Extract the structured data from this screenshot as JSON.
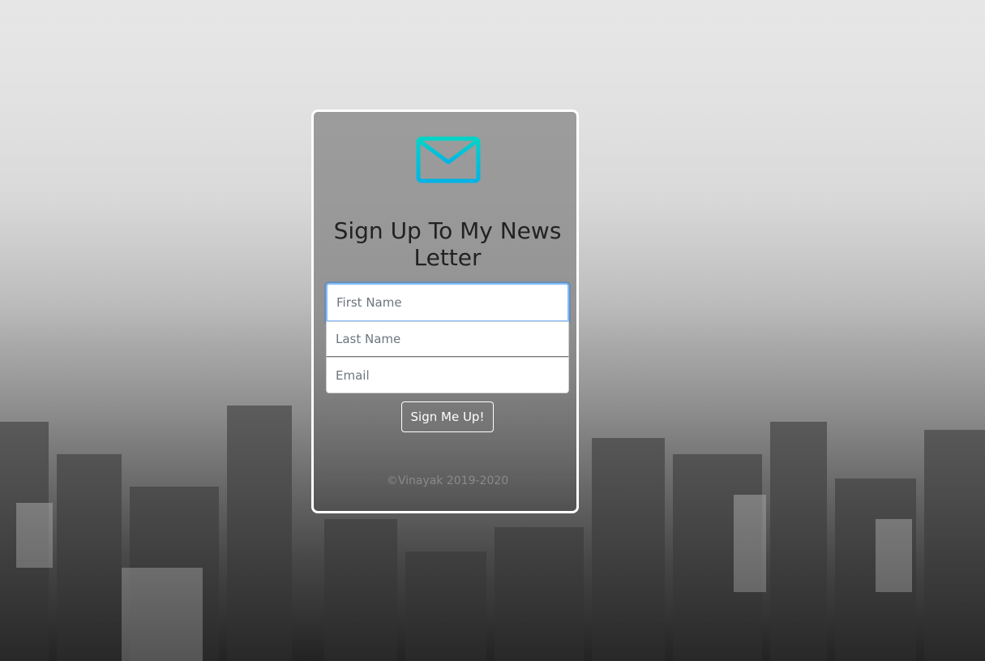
{
  "header": {
    "title": "Sign Up To My News Letter",
    "icon": "mail-icon",
    "icon_color": "#00c8d8"
  },
  "form": {
    "first_name_placeholder": "First Name",
    "last_name_placeholder": "Last Name",
    "email_placeholder": "Email",
    "submit_label": "Sign Me Up!"
  },
  "footer": {
    "copyright": "©Vinayak 2019-2020"
  },
  "colors": {
    "card_border": "#ffffff",
    "focus_ring": "#80bdff"
  }
}
